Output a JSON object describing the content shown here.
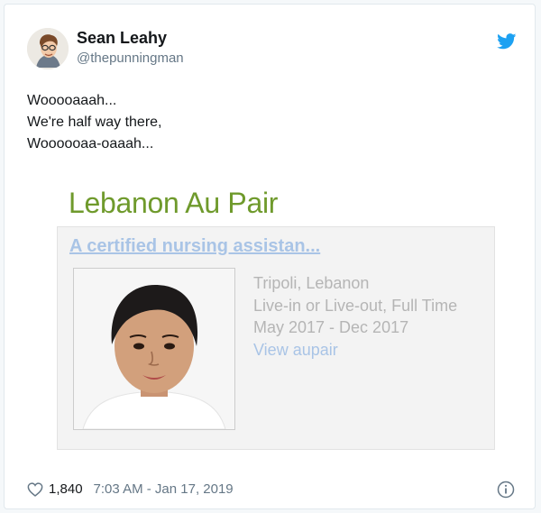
{
  "tweet": {
    "author_name": "Sean Leahy",
    "author_handle": "@thepunningman",
    "lines": [
      "Wooooaaah...",
      "We're half way there,",
      "Woooooaa-oaaah..."
    ]
  },
  "embed": {
    "site_title": "Lebanon Au Pair",
    "listing_title": "A certified nursing assistan...",
    "location": "Tripoli, Lebanon",
    "arrangement": "Live-in or Live-out, Full Time",
    "dates": "May 2017 - Dec 2017",
    "link_label": "View aupair"
  },
  "footer": {
    "likes": "1,840",
    "timestamp": "7:03 AM - Jan 17, 2019"
  },
  "colors": {
    "twitter_blue": "#1da1f2",
    "site_green": "#6f9a2c",
    "link_blue": "#a9c4e6",
    "muted_gray": "#657786"
  },
  "icons": [
    "avatar",
    "twitter-bird-icon",
    "heart-icon",
    "info-icon"
  ]
}
